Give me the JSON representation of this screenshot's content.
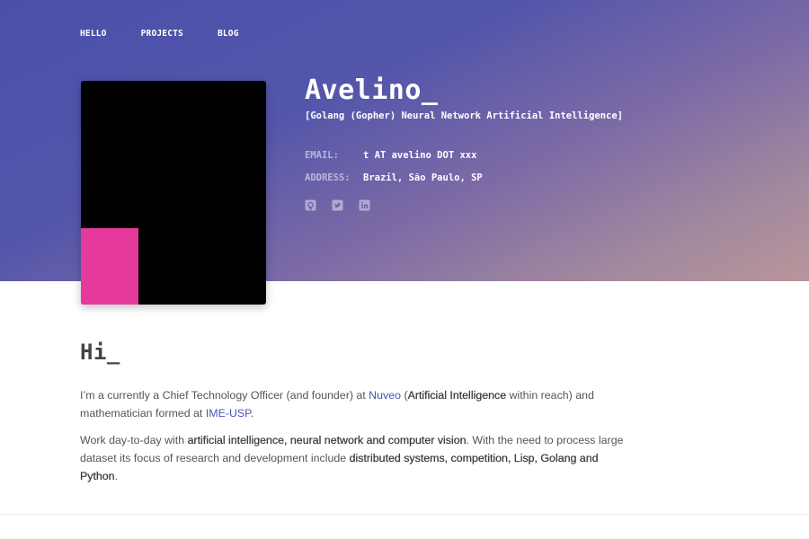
{
  "nav": {
    "items": [
      "HELLO",
      "PROJECTS",
      "BLOG"
    ]
  },
  "profile": {
    "name": "Avelino_",
    "tagline": "[Golang (Gopher) Neural Network Artificial Intelligence]",
    "email_label": "EMAIL:",
    "email_value": "t AT avelino DOT xxx",
    "address_label": "ADDRESS:",
    "address_value": "Brazil, São Paulo, SP",
    "socials": [
      "github-icon",
      "twitter-icon",
      "linkedin-icon"
    ]
  },
  "colors": {
    "hero_start": "#4b4fa9",
    "hero_end": "#b8959a",
    "avatar_accent": "#e6399c",
    "link": "#4a52b6"
  },
  "intro": {
    "heading": "Hi_",
    "p1": {
      "t1": "I’m a currently a Chief Technology Officer (and founder) at ",
      "link1": "Nuveo",
      "t2": " (",
      "b1": "Artificial Intelligence",
      "t3": " within reach) and mathematician formed at ",
      "link2": "IME-USP",
      "t4": "."
    },
    "p2": {
      "t1": "Work day-to-day with ",
      "b1": "artificial intelligence, neural network and computer vision",
      "t2": ". With the need to process large dataset its focus of research and development include ",
      "b2": "distributed systems, competition, Lisp, Golang and Python",
      "t3": "."
    }
  }
}
